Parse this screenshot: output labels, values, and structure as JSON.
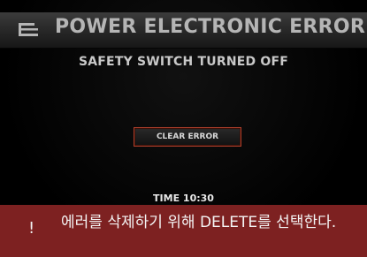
{
  "header": {
    "title": "POWER ELECTRONIC ERROR",
    "icon": "back-menu-icon"
  },
  "main": {
    "subtitle": "SAFETY SWITCH TURNED OFF",
    "clear_button_label": "CLEAR ERROR",
    "time_text": "TIME 10:30"
  },
  "notice": {
    "icon": "exclamation-icon",
    "icon_glyph": "!",
    "text": "에러를 삭제하기 위해 DELETE를 선택한다."
  },
  "colors": {
    "background": "#000000",
    "banner": "#7d2121",
    "button_border": "#b0402c",
    "title_text": "#b5b5b5"
  }
}
